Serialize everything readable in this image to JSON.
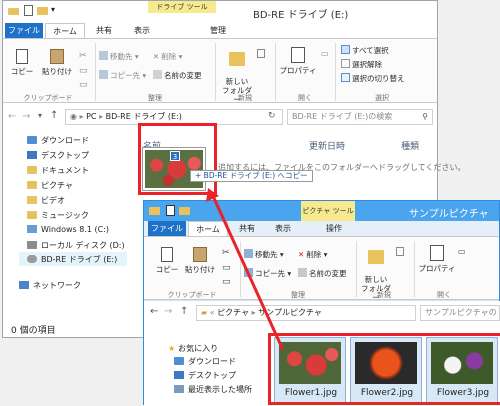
{
  "back_window": {
    "title": "BD-RE ドライブ (E:)",
    "context_tab": "ドライブ ツール",
    "tabs": [
      "ファイル",
      "ホーム",
      "共有",
      "表示",
      "管理"
    ],
    "ribbon": {
      "copy": "コピー",
      "paste": "貼り付け",
      "move_to": "移動先",
      "copy_to": "コピー先",
      "delete": "削除",
      "rename": "名前の変更",
      "new_folder": "新しい\nフォルダー",
      "properties": "プロパティ",
      "select_all": "すべて選択",
      "select_none": "選択解除",
      "invert_selection": "選択の切り替え",
      "groups": [
        "クリップボード",
        "整理",
        "新規",
        "開く",
        "選択"
      ]
    },
    "address": {
      "pc": "PC",
      "current": "BD-RE ドライブ (E:)"
    },
    "search_placeholder": "BD-RE ドライブ (E:)の検索",
    "columns": {
      "name": "名前",
      "modified": "更新日時",
      "type": "種類"
    },
    "empty_hint": "追加するには、ファイルをこのフォルダーへドラッグしてください。",
    "drag_count": "3",
    "drop_tooltip": "+ BD-RE ドライブ (E:) へコピー",
    "nav_items": [
      "ダウンロード",
      "デスクトップ",
      "ドキュメント",
      "ピクチャ",
      "ビデオ",
      "ミュージック",
      "Windows 8.1 (C:)",
      "ローカル ディスク (D:)",
      "BD-RE ドライブ (E:)",
      "ネットワーク"
    ],
    "status": "0 個の項目"
  },
  "front_window": {
    "title": "サンプルピクチャ",
    "context_tab": "ピクチャ ツール",
    "tabs": [
      "ファイル",
      "ホーム",
      "共有",
      "表示",
      "操作"
    ],
    "ribbon": {
      "copy": "コピー",
      "paste": "貼り付け",
      "move_to": "移動先",
      "copy_to": "コピー先",
      "delete": "削除",
      "rename": "名前の変更",
      "new_folder": "新しい\nフォルダー",
      "properties": "プロパティ",
      "groups": [
        "クリップボード",
        "整理",
        "新規",
        "開く"
      ]
    },
    "address": {
      "a": "ピクチャ",
      "b": "サンプルピクチャ"
    },
    "search_placeholder": "サンプルピクチャの",
    "nav_items": [
      "お気に入り",
      "ダウンロード",
      "デスクトップ",
      "最近表示した場所"
    ],
    "files": [
      "Flower1.jpg",
      "Flower2.jpg",
      "Flower3.jpg"
    ]
  },
  "colors": {
    "accent": "#1e73c8",
    "highlight": "#e8232a",
    "context_tab": "#f7e98d"
  }
}
